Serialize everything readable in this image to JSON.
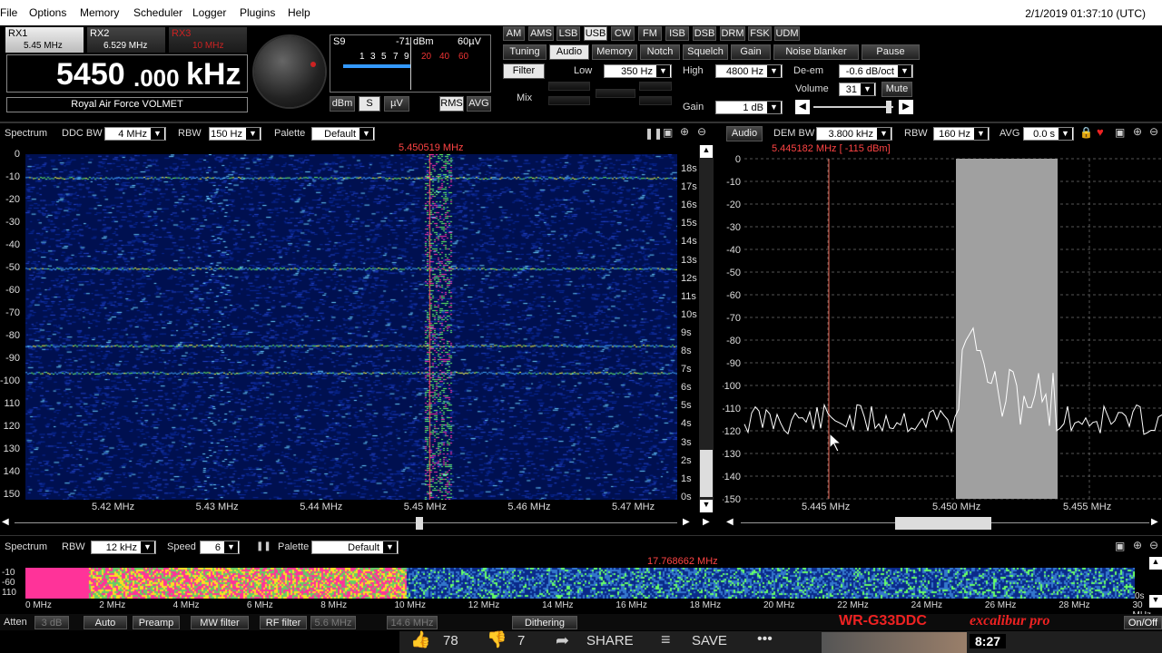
{
  "menu": {
    "items": [
      "File",
      "Options",
      "Memory",
      "Scheduler",
      "Logger",
      "Plugins",
      "Help"
    ],
    "datetime": "2/1/2019 01:37:10 (UTC)"
  },
  "receivers": {
    "rx1": {
      "label": "RX1",
      "freq": "5.45 MHz"
    },
    "rx2": {
      "label": "RX2",
      "freq": "6.529 MHz"
    },
    "rx3": {
      "label": "RX3",
      "freq": "10 MHz"
    }
  },
  "frequency": {
    "big": "5450",
    "mid": ".000",
    "unit": "kHz",
    "station": "Royal Air Force VOLMET"
  },
  "smeter": {
    "s": "S9",
    "dbm": "-71 dBm",
    "uv": "60µV",
    "scale": [
      "1",
      "3",
      "5",
      "7",
      "9",
      "20",
      "40",
      "60"
    ],
    "units": [
      "dBm",
      "S",
      "µV",
      "RMS",
      "AVG"
    ]
  },
  "modes": [
    "AM",
    "AMS",
    "LSB",
    "USB",
    "CW",
    "FM",
    "ISB",
    "DSB",
    "DRM",
    "FSK",
    "UDM"
  ],
  "tabs": [
    "Tuning",
    "Audio",
    "Memory",
    "Notch",
    "Squelch",
    "Gain",
    "Noise blanker",
    "Pause"
  ],
  "audio": {
    "filter": "Filter",
    "mix": "Mix",
    "low_label": "Low",
    "low": "350 Hz",
    "high_label": "High",
    "high": "4800 Hz",
    "deem_label": "De-em",
    "deem": "-0.6 dB/oct",
    "volume_label": "Volume",
    "volume": "31",
    "mute": "Mute",
    "gain_label": "Gain",
    "gain": "1 dB"
  },
  "spectrum": {
    "title": "Spectrum",
    "ddcbw_label": "DDC BW",
    "ddcbw": "4 MHz",
    "rbw_label": "RBW",
    "rbw": "150 Hz",
    "palette_label": "Palette",
    "palette": "Default",
    "marker": "5.450519 MHz",
    "yticks": [
      "0",
      "-10",
      "-20",
      "-30",
      "-40",
      "-50",
      "-60",
      "-70",
      "-80",
      "-90",
      "-100",
      "110",
      "120",
      "130",
      "140",
      "150"
    ],
    "tticks": [
      "18s",
      "17s",
      "16s",
      "15s",
      "14s",
      "13s",
      "12s",
      "11s",
      "10s",
      "9s",
      "8s",
      "7s",
      "6s",
      "5s",
      "4s",
      "3s",
      "2s",
      "1s",
      "0s"
    ],
    "xticks": [
      "5.42 MHz",
      "5.43 MHz",
      "5.44 MHz",
      "5.45 MHz",
      "5.46 MHz",
      "5.47 MHz"
    ]
  },
  "audiopane": {
    "title": "Audio",
    "dembw_label": "DEM BW",
    "dembw": "3.800 kHz",
    "rbw_label": "RBW",
    "rbw": "160 Hz",
    "avg_label": "AVG",
    "avg": "0.0 s",
    "marker": "5.445182 MHz [ -115 dBm]",
    "yticks": [
      "0",
      "-10",
      "-20",
      "-30",
      "-40",
      "-50",
      "-60",
      "-70",
      "-80",
      "-90",
      "-100",
      "-110",
      "-120",
      "-130",
      "-140",
      "-150"
    ],
    "xticks": [
      "5.445 MHz",
      "5.450 MHz",
      "5.455 MHz"
    ]
  },
  "wide": {
    "title": "Spectrum",
    "rbw_label": "RBW",
    "rbw": "12 kHz",
    "speed_label": "Speed",
    "speed": "6",
    "palette_label": "Palette",
    "palette": "Default",
    "marker": "17.768662 MHz",
    "yticks": [
      "-10",
      "-60",
      "110"
    ],
    "xticks": [
      "0 MHz",
      "2 MHz",
      "4 MHz",
      "6 MHz",
      "8 MHz",
      "10 MHz",
      "12 MHz",
      "14 MHz",
      "16 MHz",
      "18 MHz",
      "20 MHz",
      "22 MHz",
      "24 MHz",
      "26 MHz",
      "28 MHz",
      "30 MHz"
    ],
    "side": [
      "0s"
    ]
  },
  "bottom": {
    "atten": "Atten",
    "atten_val": "3 dB",
    "auto": "Auto",
    "preamp": "Preamp",
    "mwfilter": "MW filter",
    "rffilter": "RF filter",
    "rf_val": "5.6 MHz",
    "val2": "14.6 MHz",
    "dithering": "Dithering",
    "brand": "WR-G33DDC",
    "brand2": "excalibur pro",
    "onoff": "On/Off"
  },
  "overlay": {
    "likes": "78",
    "dislikes": "7",
    "share": "SHARE",
    "save": "SAVE",
    "time": "8:27"
  }
}
